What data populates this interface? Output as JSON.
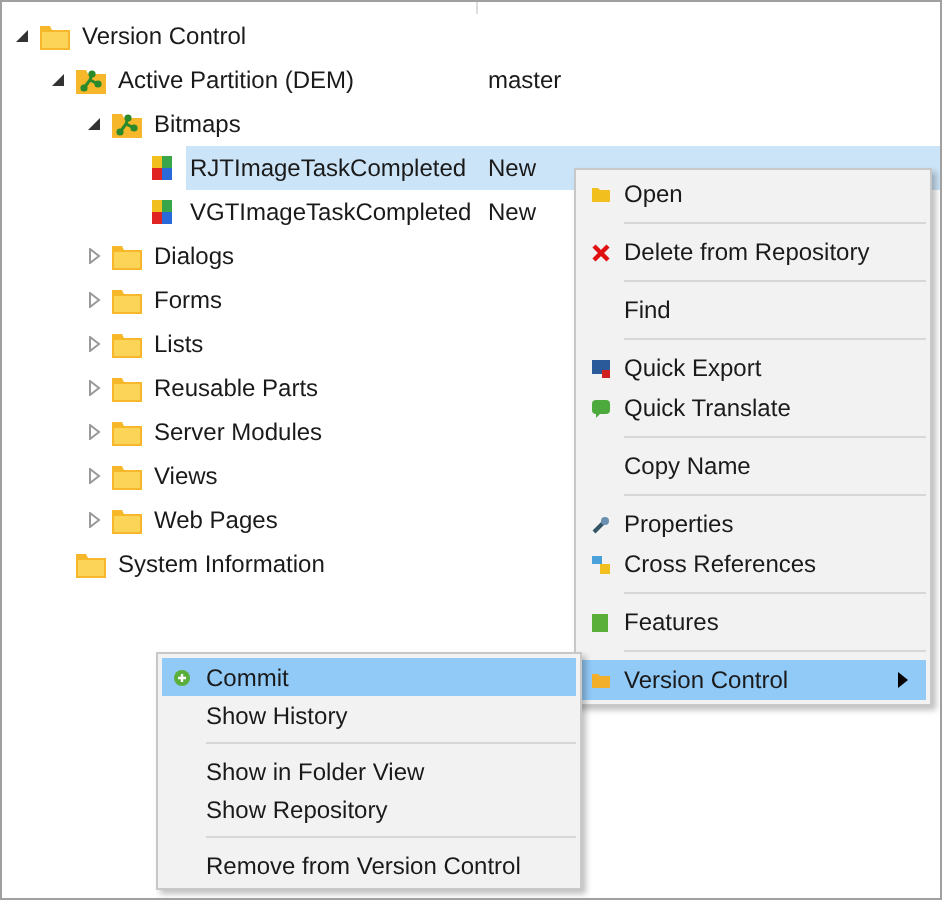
{
  "tree": [
    {
      "label": "Version Control",
      "kind": "folder",
      "expanded": true,
      "selected": false,
      "children": [
        {
          "label": "Active Partition (DEM)",
          "value": "master",
          "kind": "partition",
          "expanded": true,
          "selected": false,
          "children": [
            {
              "label": "Bitmaps",
              "kind": "partition",
              "expanded": true,
              "selected": false,
              "children": [
                {
                  "label": "RJTImageTaskCompleted",
                  "value": "New",
                  "kind": "bitmap",
                  "selected": true
                },
                {
                  "label": "VGTImageTaskCompleted",
                  "value": "New",
                  "kind": "bitmap",
                  "selected": false
                }
              ]
            },
            {
              "label": "Dialogs",
              "kind": "folder",
              "expanded": false,
              "selected": false
            },
            {
              "label": "Forms",
              "kind": "folder",
              "expanded": false,
              "selected": false
            },
            {
              "label": "Lists",
              "kind": "folder",
              "expanded": false,
              "selected": false
            },
            {
              "label": "Reusable Parts",
              "kind": "folder",
              "expanded": false,
              "selected": false
            },
            {
              "label": "Server Modules",
              "kind": "folder",
              "expanded": false,
              "selected": false
            },
            {
              "label": "Views",
              "kind": "folder",
              "expanded": false,
              "selected": false
            },
            {
              "label": "Web Pages",
              "kind": "folder",
              "expanded": false,
              "selected": false
            }
          ]
        },
        {
          "label": "System Information",
          "kind": "folder",
          "selected": false
        }
      ]
    }
  ],
  "context_menu": {
    "groups": [
      [
        {
          "label": "Open",
          "kind": "open",
          "selected": false,
          "has_submenu": false
        }
      ],
      [
        {
          "label": "Delete from Repository",
          "kind": "delete",
          "selected": false,
          "has_submenu": false
        }
      ],
      [
        {
          "label": "Find",
          "kind": "none",
          "selected": false,
          "has_submenu": false
        }
      ],
      [
        {
          "label": "Quick Export",
          "kind": "export",
          "selected": false,
          "has_submenu": false
        },
        {
          "label": "Quick Translate",
          "kind": "translate",
          "selected": false,
          "has_submenu": false
        }
      ],
      [
        {
          "label": "Copy Name",
          "kind": "none",
          "selected": false,
          "has_submenu": false
        }
      ],
      [
        {
          "label": "Properties",
          "kind": "properties",
          "selected": false,
          "has_submenu": false
        },
        {
          "label": "Cross References",
          "kind": "references",
          "selected": false,
          "has_submenu": false
        }
      ],
      [
        {
          "label": "Features",
          "kind": "features",
          "selected": false,
          "has_submenu": false
        }
      ],
      [
        {
          "label": "Version Control",
          "kind": "version",
          "selected": true,
          "has_submenu": true
        }
      ]
    ]
  },
  "submenu": {
    "groups": [
      [
        {
          "label": "Commit",
          "kind": "commit",
          "selected": true
        },
        {
          "label": "Show History",
          "kind": "none",
          "selected": false
        }
      ],
      [
        {
          "label": "Show in Folder View",
          "kind": "none",
          "selected": false
        },
        {
          "label": "Show Repository",
          "kind": "none",
          "selected": false
        }
      ],
      [
        {
          "label": "Remove from Version Control",
          "kind": "none",
          "selected": false
        }
      ]
    ]
  }
}
